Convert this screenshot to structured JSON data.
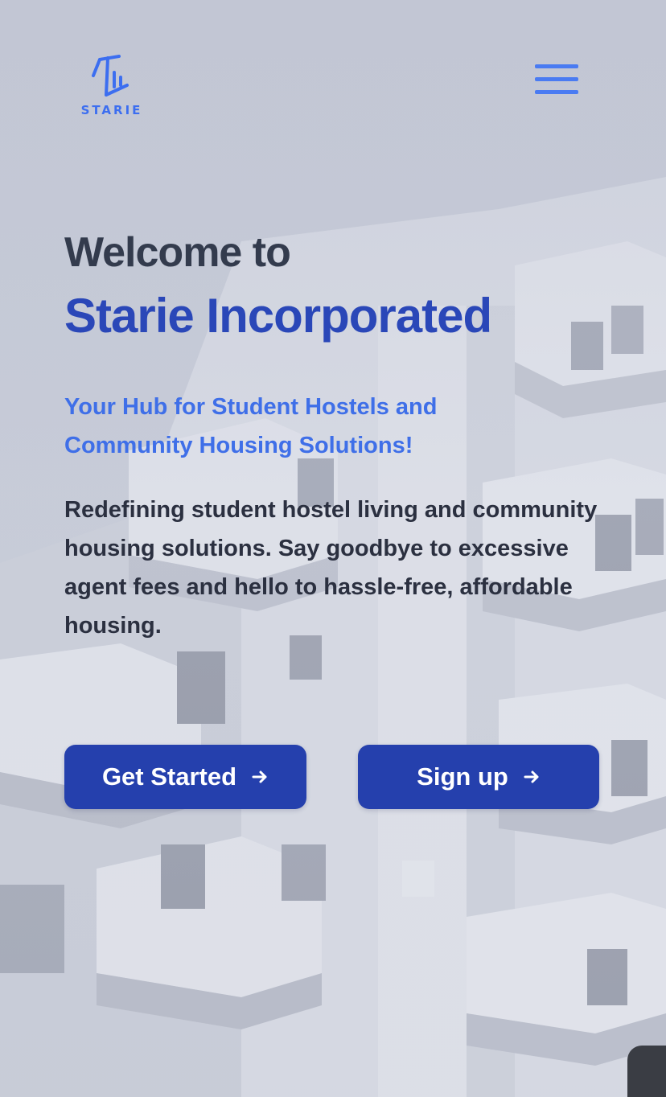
{
  "header": {
    "logo_text": "STARIE",
    "logo_icon": "starie-logo-icon",
    "menu_icon": "hamburger-menu-icon"
  },
  "hero": {
    "welcome": "Welcome to",
    "brand": "Starie Incorporated",
    "tagline": "Your Hub for Student Hostels and Community Housing Solutions!",
    "body": "Redefining student hostel living and community housing solutions. Say goodbye to excessive agent fees and hello to hassle-free, affordable housing."
  },
  "actions": {
    "get_started_label": "Get Started",
    "sign_up_label": "Sign up",
    "arrow_icon": "arrow-right-icon"
  },
  "colors": {
    "brand_primary": "#2a47b8",
    "button_bg": "#2540ad",
    "accent_blue": "#3f6fe8",
    "heading_dark": "#333b4d",
    "body_text": "#2b3040"
  }
}
